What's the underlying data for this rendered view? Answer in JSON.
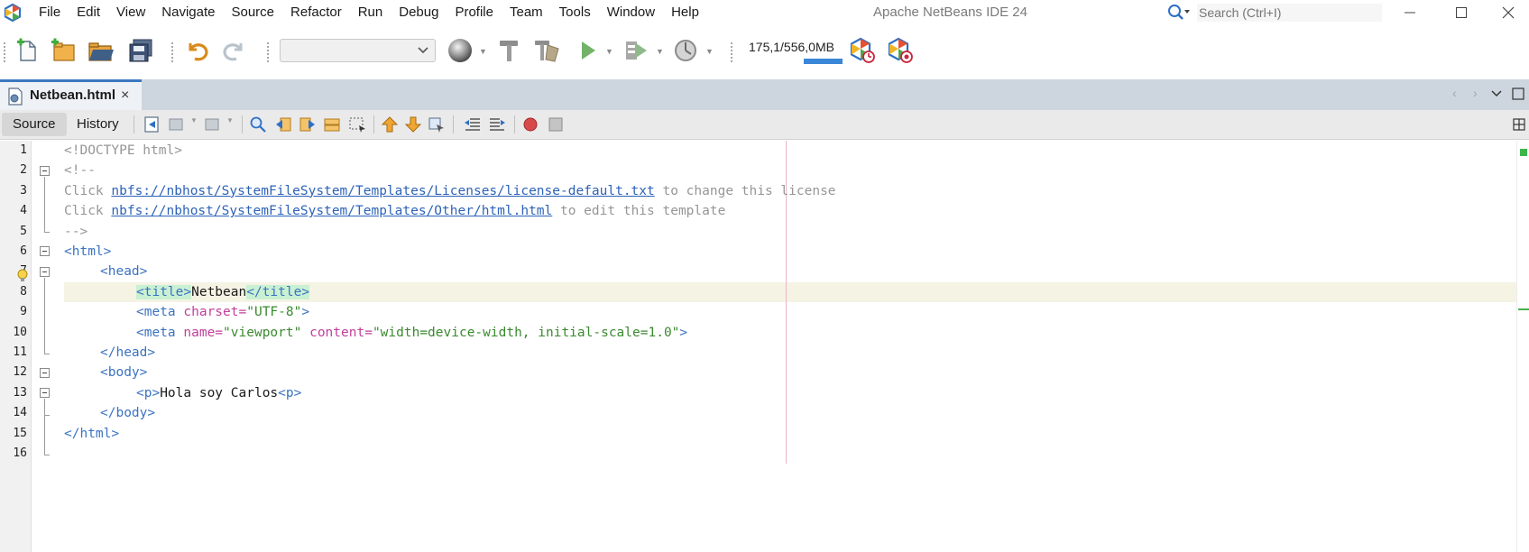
{
  "menu": {
    "items": [
      "File",
      "Edit",
      "View",
      "Navigate",
      "Source",
      "Refactor",
      "Run",
      "Debug",
      "Profile",
      "Team",
      "Tools",
      "Window",
      "Help"
    ]
  },
  "window": {
    "title": "Apache NetBeans IDE 24"
  },
  "search": {
    "placeholder": "Search (Ctrl+I)"
  },
  "toolbar": {
    "config_value": "",
    "memory": "175,1/556,0MB",
    "memory_fraction": 0.31
  },
  "editor_tab": {
    "label": "Netbean.html",
    "close_glyph": "×"
  },
  "editor_subtabs": {
    "source": "Source",
    "history": "History"
  },
  "icons": {
    "app": "netbeans-logo-icon",
    "new_file": "new-file-icon",
    "new_project": "new-project-icon",
    "open_project": "open-project-icon",
    "save_all": "save-all-icon",
    "undo": "undo-icon",
    "redo": "redo-icon",
    "browser": "globe-icon",
    "build": "hammer-icon",
    "clean_build": "clean-build-icon",
    "run": "run-icon",
    "debug": "debug-icon",
    "profile": "profile-icon",
    "gc": "gc-icon",
    "profile_ide": "profile-ide-icon",
    "hint": "lightbulb-icon"
  },
  "colors": {
    "tag": "#3b73c2",
    "attribute": "#c03f9b",
    "value": "#3a8a2e",
    "comment": "#969696",
    "link": "#2d63b8",
    "active_tab_border": "#3c78c0"
  },
  "editor": {
    "line_numbers": [
      "1",
      "2",
      "3",
      "4",
      "5",
      "6",
      "7",
      "8",
      "9",
      "10",
      "11",
      "12",
      "13",
      "14",
      "15",
      "16"
    ],
    "current_line": "8",
    "lines": {
      "l1": "<!DOCTYPE html>",
      "l2": "<!--",
      "l3_pre": "Click ",
      "l3_link": "nbfs://nbhost/SystemFileSystem/Templates/Licenses/license-default.txt",
      "l3_post": " to change this license",
      "l4_pre": "Click ",
      "l4_link": "nbfs://nbhost/SystemFileSystem/Templates/Other/html.html",
      "l4_post": " to edit this template",
      "l5": "-->",
      "l6": "<html>",
      "l7": "<head>",
      "l8_open": "<title>",
      "l8_text": "Netbean",
      "l8_close": "</title>",
      "l9_tag": "<meta ",
      "l9_attr": "charset=",
      "l9_val": "\"UTF-8\"",
      "l9_end": ">",
      "l10_tag": "<meta ",
      "l10_attr1": "name=",
      "l10_val1": "\"viewport\"",
      "l10_attr2": " content=",
      "l10_val2": "\"width=device-width, initial-scale=1.0\"",
      "l10_end": ">",
      "l11": "</head>",
      "l12": "<body>",
      "l13_open": "<p>",
      "l13_text": "Hola soy Carlos",
      "l13_close": "<p>",
      "l14": "</body>",
      "l15": "</html>",
      "l16": ""
    }
  }
}
